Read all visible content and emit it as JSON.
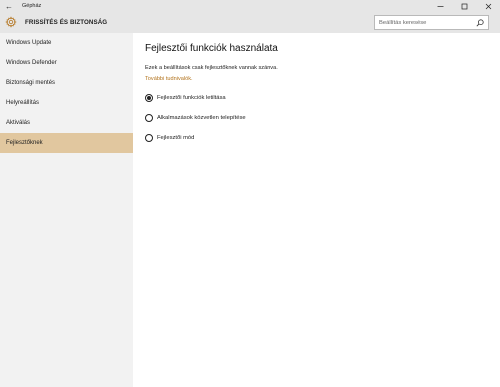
{
  "window": {
    "title": "Gépház",
    "back_glyph": "←",
    "controls": [
      "minimize-icon",
      "maximize-icon",
      "close-icon"
    ]
  },
  "header": {
    "section_title": "FRISSÍTÉS ÉS BIZTONSÁG",
    "icon": "gear-icon",
    "search": {
      "placeholder": "Beállítás keresése",
      "icon": "search-icon"
    }
  },
  "sidebar": {
    "items": [
      {
        "label": "Windows Update",
        "active": false
      },
      {
        "label": "Windows Defender",
        "active": false
      },
      {
        "label": "Biztonsági mentés",
        "active": false
      },
      {
        "label": "Helyreállítás",
        "active": false
      },
      {
        "label": "Aktiválás",
        "active": false
      },
      {
        "label": "Fejlesztőknek",
        "active": true
      }
    ]
  },
  "main": {
    "title": "Fejlesztői funkciók használata",
    "description": "Ezek a beállítások csak fejlesztőknek vannak szánva.",
    "link": "További tudnivalók.",
    "options": [
      {
        "label": "Fejlesztői funkciók letiltása",
        "selected": true
      },
      {
        "label": "Alkalmazások közvetlen telepítése",
        "selected": false
      },
      {
        "label": "Fejlesztői mód",
        "selected": false
      }
    ]
  },
  "colors": {
    "accent": "#e1c79f",
    "link": "#b3741e",
    "header_bg": "#e6e6e6",
    "sidebar_bg": "#f2f2f2"
  }
}
